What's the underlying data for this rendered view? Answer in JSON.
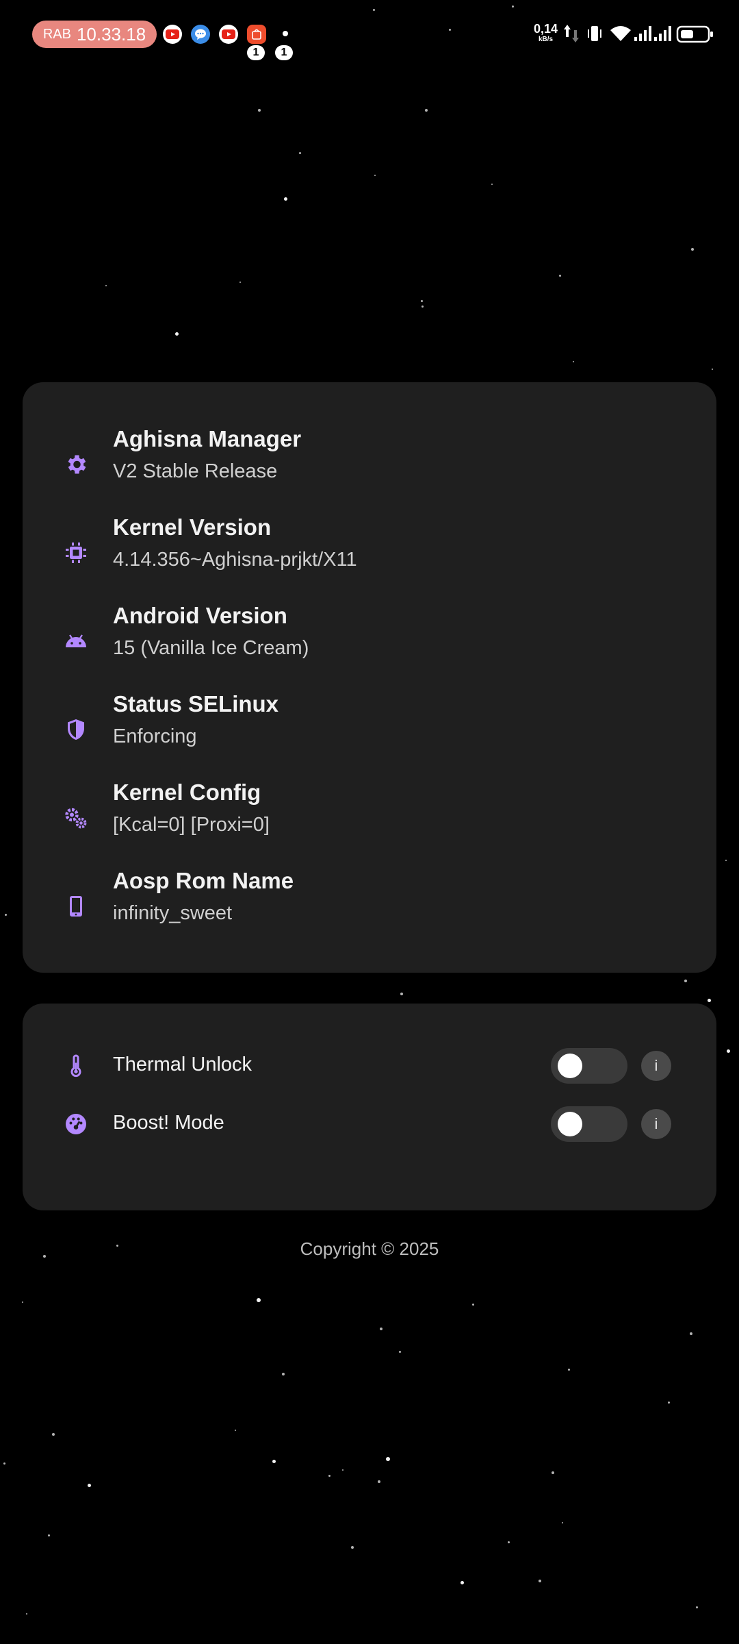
{
  "status_bar": {
    "day": "RAB",
    "time": "10.33.18",
    "notification_badges": [
      "1",
      "1"
    ],
    "net_speed_value": "0,14",
    "net_speed_unit": "kB/s",
    "notification_icons": [
      "youtube-icon",
      "messenger-icon",
      "youtube-icon",
      "shopee-icon",
      "dot-icon"
    ],
    "right_icons": [
      "upload-arrow-icon",
      "download-arrow-icon",
      "vibrate-icon",
      "wifi-icon",
      "signal-icon",
      "signal-icon",
      "battery-icon"
    ]
  },
  "info_card": {
    "items": [
      {
        "icon": "gear-icon",
        "title": "Aghisna Manager",
        "value": "V2 Stable Release"
      },
      {
        "icon": "cpu-chip-icon",
        "title": "Kernel Version",
        "value": "4.14.356~Aghisna-prjkt/X11"
      },
      {
        "icon": "android-icon",
        "title": "Android Version",
        "value": "15  (Vanilla Ice Cream)"
      },
      {
        "icon": "shield-icon",
        "title": "Status SELinux",
        "value": "Enforcing"
      },
      {
        "icon": "gears-icon",
        "title": "Kernel Config",
        "value": "[Kcal=0] [Proxi=0]"
      },
      {
        "icon": "phone-icon",
        "title": "Aosp Rom Name",
        "value": "infinity_sweet"
      }
    ]
  },
  "toggle_card": {
    "items": [
      {
        "icon": "thermometer-icon",
        "label": "Thermal Unlock",
        "enabled": false,
        "info_label": "i"
      },
      {
        "icon": "speedometer-icon",
        "label": "Boost! Mode",
        "enabled": false,
        "info_label": "i"
      }
    ]
  },
  "footer": {
    "copyright": "Copyright © 2025"
  },
  "colors": {
    "accent": "#b388ff",
    "card_bg": "#1f1f1f",
    "background": "#000000",
    "clock_pill": "#e8877f"
  }
}
